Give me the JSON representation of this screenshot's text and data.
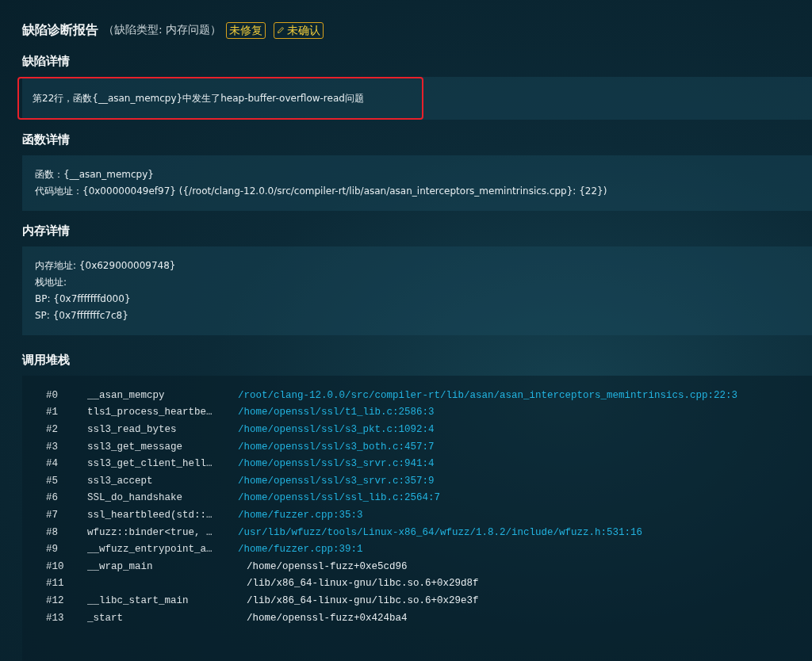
{
  "header": {
    "title": "缺陷诊断报告",
    "subtitle": "（缺陷类型: 内存问题）",
    "badges": [
      {
        "kind": "plain",
        "text": "未修复"
      },
      {
        "kind": "editable",
        "text": "未确认"
      }
    ]
  },
  "defect_details": {
    "heading": "缺陷详情",
    "highlighted": true,
    "text": "第22行，函数{__asan_memcpy}中发生了heap-buffer-overflow-read问题"
  },
  "function_details": {
    "heading": "函数详情",
    "lines": [
      "函数：{__asan_memcpy}",
      "代码地址：{0x00000049ef97}  ({/root/clang-12.0.0/src/compiler-rt/lib/asan/asan_interceptors_memintrinsics.cpp}: {22})"
    ]
  },
  "memory_details": {
    "heading": "内存详情",
    "lines": [
      "内存地址: {0x629000009748}",
      "栈地址:",
      "BP: {0x7fffffffd000}",
      "SP: {0x7fffffffc7c8}"
    ]
  },
  "call_stack": {
    "heading": "调用堆栈",
    "frames": [
      {
        "index": "#0",
        "function": "__asan_memcpy",
        "location": "/root/clang-12.0.0/src/compiler-rt/lib/asan/asan_interceptors_memintrinsics.cpp:22:3",
        "kind": "source"
      },
      {
        "index": "#1",
        "function": "tls1_process_heartbe…",
        "location": "/home/openssl/ssl/t1_lib.c:2586:3",
        "kind": "source"
      },
      {
        "index": "#2",
        "function": "ssl3_read_bytes",
        "location": "/home/openssl/ssl/s3_pkt.c:1092:4",
        "kind": "source"
      },
      {
        "index": "#3",
        "function": "ssl3_get_message",
        "location": "/home/openssl/ssl/s3_both.c:457:7",
        "kind": "source"
      },
      {
        "index": "#4",
        "function": "ssl3_get_client_hell…",
        "location": "/home/openssl/ssl/s3_srvr.c:941:4",
        "kind": "source"
      },
      {
        "index": "#5",
        "function": "ssl3_accept",
        "location": "/home/openssl/ssl/s3_srvr.c:357:9",
        "kind": "source"
      },
      {
        "index": "#6",
        "function": "SSL_do_handshake",
        "location": "/home/openssl/ssl/ssl_lib.c:2564:7",
        "kind": "source"
      },
      {
        "index": "#7",
        "function": "ssl_heartbleed(std::…",
        "location": "/home/fuzzer.cpp:35:3",
        "kind": "source"
      },
      {
        "index": "#8",
        "function": "wfuzz::binder<true, …",
        "location": "/usr/lib/wfuzz/tools/Linux-x86_64/wfuzz/1.8.2/include/wfuzz.h:531:16",
        "kind": "source"
      },
      {
        "index": "#9",
        "function": "__wfuzz_entrypoint_a…",
        "location": "/home/fuzzer.cpp:39:1",
        "kind": "source"
      },
      {
        "index": "#10",
        "function": "__wrap_main",
        "location": "/home/openssl-fuzz+0xe5cd96",
        "kind": "binary"
      },
      {
        "index": "#11",
        "location": "/lib/x86_64-linux-gnu/libc.so.6+0x29d8f",
        "kind": "binary"
      },
      {
        "index": "#12",
        "function": "__libc_start_main",
        "location": "/lib/x86_64-linux-gnu/libc.so.6+0x29e3f",
        "kind": "binary"
      },
      {
        "index": "#13",
        "function": "_start",
        "location": "/home/openssl-fuzz+0x424ba4",
        "kind": "binary"
      }
    ]
  }
}
